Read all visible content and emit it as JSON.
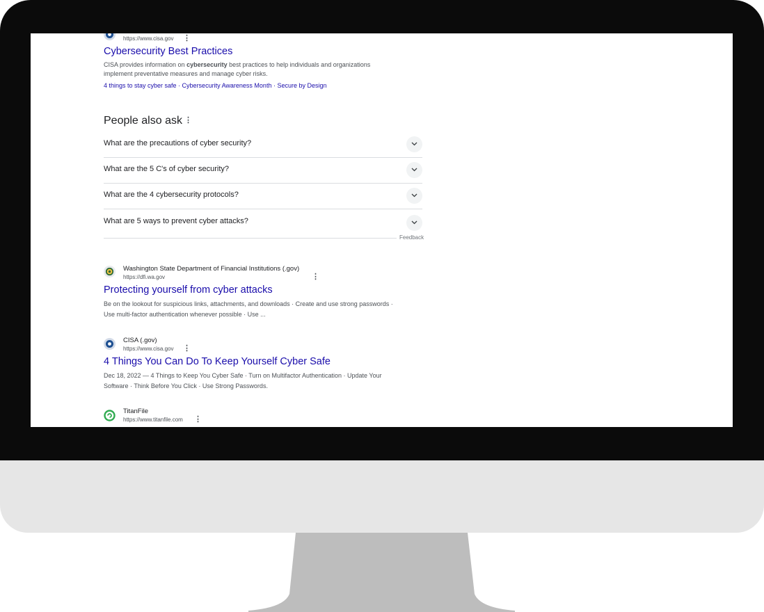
{
  "results": [
    {
      "url": "https://www.cisa.gov",
      "title": "Cybersecurity Best Practices",
      "snippet_before": "CISA provides information on ",
      "snippet_bold": "cybersecurity",
      "snippet_after": " best practices to help individuals and organizations",
      "snippet_line2": "implement preventative measures and manage cyber risks.",
      "sitelinks": "4 things to stay cyber safe · Cybersecurity Awareness Month · Secure by Design"
    },
    {
      "site": "Washington State Department of Financial Institutions (.gov)",
      "url": "https://dfi.wa.gov",
      "title": "Protecting yourself from cyber attacks",
      "snippet_line1": "Be on the lookout for suspicious links, attachments, and downloads · Create and use strong passwords ·",
      "snippet_line2": "Use multi-factor authentication whenever possible · Use ..."
    },
    {
      "site": "CISA (.gov)",
      "url": "https://www.cisa.gov",
      "title": "4 Things You Can Do To Keep Yourself Cyber Safe",
      "snippet_line1": "Dec 18, 2022 — 4 Things to Keep You Cyber Safe · Turn on Multifactor Authentication · Update Your",
      "snippet_line2": "Software · Think Before You Click · Use Strong Passwords."
    },
    {
      "site": "TitanFile",
      "url": "https://www.titanfile.com"
    }
  ],
  "people_also_ask": {
    "title": "People also ask",
    "questions": [
      "What are the precautions of cyber security?",
      "What are the 5 C's of cyber security?",
      "What are the 4 cybersecurity protocols?",
      "What are 5 ways to prevent cyber attacks?"
    ],
    "feedback": "Feedback"
  },
  "icons": {
    "more": "more-vert-icon",
    "expand": "chevron-down-icon"
  },
  "colors": {
    "link": "#1a0dab",
    "bezel": "#0b0b0b",
    "chin": "#e6e6e6",
    "stand": "#bdbdbd"
  }
}
